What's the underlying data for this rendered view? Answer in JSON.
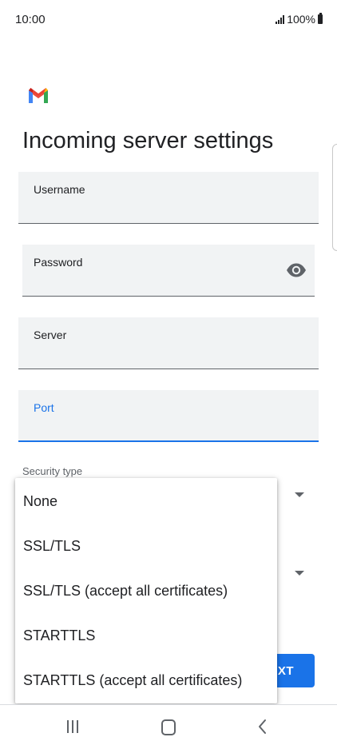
{
  "status_bar": {
    "time": "10:00",
    "battery": "100%"
  },
  "header": {
    "app_icon": "gmail-logo",
    "title": "Incoming server settings"
  },
  "form": {
    "username_label": "Username",
    "username_value": "",
    "password_label": "Password",
    "password_value": "",
    "server_label": "Server",
    "server_value": "",
    "port_label": "Port",
    "port_value": "",
    "security_type_label": "Security type"
  },
  "dropdown": {
    "options": [
      "None",
      "SSL/TLS",
      "SSL/TLS (accept all certificates)",
      "STARTTLS",
      "STARTTLS (accept all certificates)"
    ]
  },
  "next_button": {
    "label_visible": "XT"
  },
  "colors": {
    "accent": "#1a73e8",
    "field_bg": "#f1f3f4",
    "text": "#202124"
  },
  "nav_icons": [
    "recents-icon",
    "home-icon",
    "back-icon"
  ]
}
